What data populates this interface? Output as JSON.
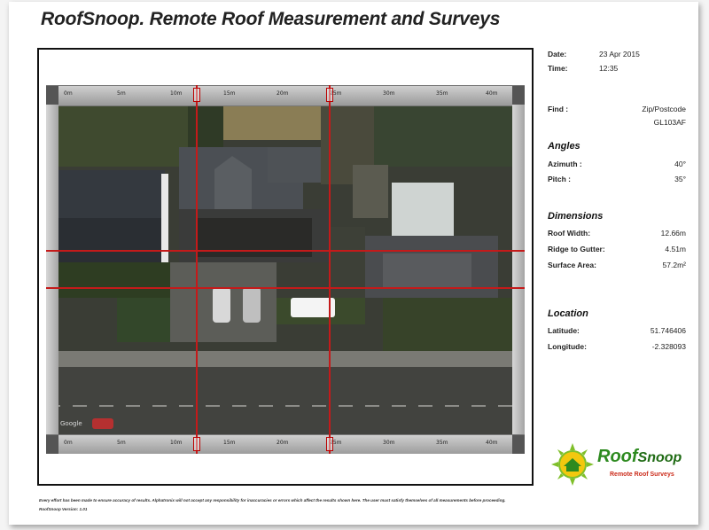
{
  "title": "RoofSnoop. Remote Roof Measurement and Surveys",
  "meta": {
    "date_label": "Date:",
    "date_value": "23 Apr 2015",
    "time_label": "Time:",
    "time_value": "12:35"
  },
  "find": {
    "label": "Find :",
    "line1": "Zip/Postcode",
    "line2": "GL103AF"
  },
  "angles": {
    "heading": "Angles",
    "azimuth_label": "Azimuth :",
    "azimuth_value": "40°",
    "pitch_label": "Pitch :",
    "pitch_value": "35°"
  },
  "dimensions": {
    "heading": "Dimensions",
    "roof_width_label": "Roof Width:",
    "roof_width_value": "12.66m",
    "ridge_label": "Ridge to Gutter:",
    "ridge_value": "4.51m",
    "area_label": "Surface Area:",
    "area_value": "57.2m²"
  },
  "location": {
    "heading": "Location",
    "lat_label": "Latitude:",
    "lat_value": "51.746406",
    "lon_label": "Longitude:",
    "lon_value": "-2.328093"
  },
  "ruler": {
    "labels": [
      "0m",
      "5m",
      "10m",
      "15m",
      "20m",
      "25m",
      "30m",
      "35m",
      "40m"
    ]
  },
  "map_attribution": "Google",
  "logo": {
    "name": "RoofSnoop",
    "roof": "Roof",
    "snoop": "Snoop",
    "tagline": "Remote Roof Surveys"
  },
  "footer": {
    "disclaimer": "Every effort has been made to ensure accuracy of results. Alphatronix will not accept any responsibility for inaccuracies or errors which affect the results shown here. The user must satisfy themselves of all measurements before proceeding.",
    "version": "RoofSnoop Version: 1.01"
  },
  "colors": {
    "guide_red": "#c41a1a",
    "logo_green": "#2d8a1f",
    "logo_red": "#cc2d1c",
    "sun_yellow": "#f2c80f"
  }
}
